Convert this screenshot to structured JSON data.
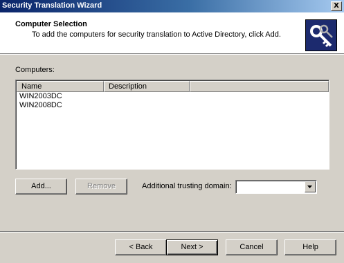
{
  "window": {
    "title": "Security Translation Wizard",
    "close_glyph": "X"
  },
  "header": {
    "title": "Computer Selection",
    "subtitle": "To add the computers for security translation to Active Directory, click Add.",
    "icon": "key-icon"
  },
  "computers": {
    "label": "Computers:",
    "columns": [
      "Name",
      "Description"
    ],
    "rows": [
      {
        "name": "WIN2003DC",
        "description": ""
      },
      {
        "name": "WIN2008DC",
        "description": ""
      }
    ]
  },
  "actions": {
    "add_label": "Add...",
    "remove_label": "Remove",
    "remove_enabled": false,
    "domain_label": "Additional trusting domain:",
    "domain_value": ""
  },
  "footer": {
    "back_label": "< Back",
    "next_label": "Next >",
    "cancel_label": "Cancel",
    "help_label": "Help"
  }
}
